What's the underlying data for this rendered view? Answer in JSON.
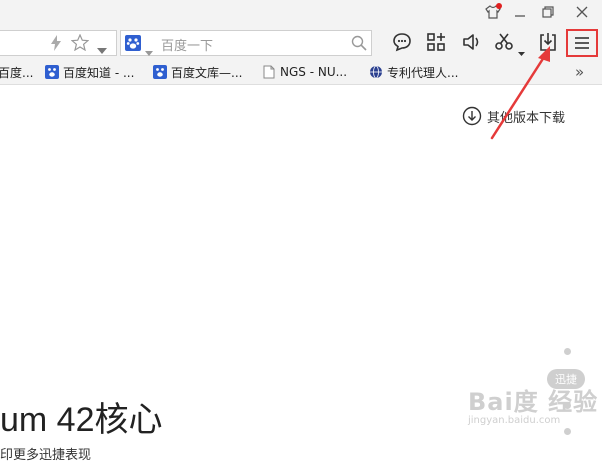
{
  "window": {
    "icons": [
      "shirt-skin-icon",
      "minimize-icon",
      "restore-icon",
      "close-icon"
    ]
  },
  "toolbar": {
    "search_placeholder": "百度一下",
    "icons": [
      "lightning-icon",
      "star-icon",
      "chevron-down-icon",
      "baidu-paw-icon",
      "search-icon",
      "chat-icon",
      "apps-grid-icon",
      "speaker-icon",
      "scissors-icon",
      "download-icon",
      "menu-icon"
    ],
    "menu_highlight_color": "#e53a3a"
  },
  "bookmarks": {
    "items": [
      {
        "label": "百度..."
      },
      {
        "label": "百度知道 - ..."
      },
      {
        "label": "百度文库—..."
      },
      {
        "label": "NGS - NU..."
      },
      {
        "label": "专利代理人..."
      }
    ],
    "overflow_label": "»"
  },
  "content": {
    "other_versions_label": "其他版本下载",
    "title": "um 42核心",
    "subtitle": "印更多迅捷表现",
    "xunjie_badge": "迅捷",
    "annotation_arrow_color": "#e53a3a"
  },
  "watermark": {
    "brand": "Bai度 经验",
    "url": "jingyan.baidu.com"
  }
}
